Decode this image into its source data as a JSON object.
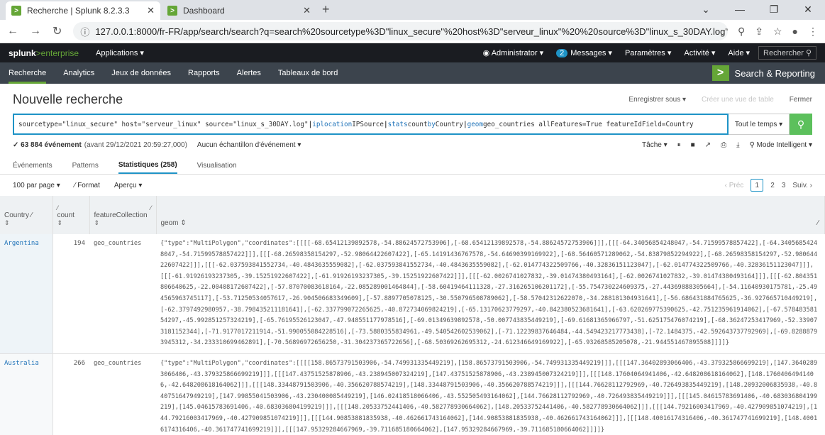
{
  "browser": {
    "tabs": [
      {
        "title": "Recherche | Splunk 8.2.3.3"
      },
      {
        "title": "Dashboard"
      }
    ],
    "url": "127.0.0.1:8000/fr-FR/app/search/search?q=search%20sourcetype%3D\"linux_secure\"%20host%3D\"serveur_linux\"%20%20source%3D\"linux_s_30DAY.log\"%2..."
  },
  "top": {
    "logo_a": "splunk",
    "logo_b": ">enterprise",
    "apps": "Applications ▾",
    "admin": "Administrator ▾",
    "msg_count": "2",
    "messages": "Messages ▾",
    "params": "Paramètres ▾",
    "activite": "Activité ▾",
    "aide": "Aide ▾",
    "search_btn": "Rechercher"
  },
  "nav": {
    "items": [
      "Recherche",
      "Analytics",
      "Jeux de données",
      "Rapports",
      "Alertes",
      "Tableaux de bord"
    ],
    "app": "Search & Reporting"
  },
  "page": {
    "title": "Nouvelle recherche",
    "save": "Enregistrer sous ▾",
    "create": "Créer une vue de table",
    "close": "Fermer"
  },
  "search": {
    "q1": "sourcetype=\"linux_secure\" host=\"serveur_linux\"  source=\"linux_s_30DAY.log\" ",
    "p1": "| ",
    "c1": "iplocation",
    "a1": " IPSource ",
    "p2": "| ",
    "c2": "stats",
    "a2": " count ",
    "k2": "by",
    " a2b": "",
    "a2c": " Country ",
    "p3": "| ",
    "c3": "geom",
    "a3": " geo_countries allFeatures=True featureIdField=Country",
    "time": "Tout le temps ▾"
  },
  "info": {
    "count": "✓ 63 884 événement",
    "range": "(avant 29/12/2021 20:59:27,000)",
    "sampling": "Aucun échantillon d'événement ▾",
    "job": "Tâche ▾",
    "mode": "⚲ Mode Intelligent ▾"
  },
  "tabs": [
    "Événements",
    "Patterns",
    "Statistiques (258)",
    "Visualisation"
  ],
  "tools": {
    "per_page": "100 par page ▾",
    "format": "⁄ Format",
    "preview": "Aperçu ▾",
    "prev": "‹ Préc",
    "p1": "1",
    "p2": "2",
    "p3": "3",
    "next": "Suiv. ›"
  },
  "table": {
    "headers": [
      "Country",
      "count",
      "featureCollection",
      "geom ⇕"
    ],
    "rows": [
      {
        "country": "Argentina",
        "count": "194",
        "fc": "geo_countries",
        "geom": "{\"type\":\"MultiPolygon\",\"coordinates\":[[[[-68.65412139892578,-54.88624572753906],[-68.65412139892578,-54.88624572753906]]],[[[-64.34056854248047,-54.71599578857422],[-64.34056854248047,-54.71599578857422]]],[[[-68.26598358154297,-52.98064422607422],[-65.14191436767578,-54.64690399169922],[-68.56460571289062,-54.83879852294922],[-68.26598358154297,-52.98064422607422]]],[[[-62.037593841552734,-40.4843635559082],[-62.037593841552734,-40.4843635559082],[-62.014774322509766,-40.32836151123047],[-62.014774322509766,-40.32836151123047]]],[[[-61.91926193237305,-39.15251922607422],[-61.91926193237305,-39.15251922607422]]],[[[-62.0026741027832,-39.01474380493164],[-62.0026741027832,-39.01474380493164]]],[[[-62.804351806640625,-22.00408172607422],[-57.87070083618164,-22.085289001464844],[-58.60419464111328,-27.316265106201172],[-55.754730224609375,-27.44369888305664],[-54.11640930175781,-25.494565963745117],[-53.71250534057617,-26.904506683349609],[-57.8897705078125,-30.550796508789062],[-58.57042312622070,-34.288181304931641],[-56.686431884765625,-36.927665710449219],[-62.3797492980957,-38.798435211181641],[-62.337799072265625,-40.872734069824219],[-65.13170623779297,-40.842380523681641],[-63.620269775390625,-42.751235961914062],[-67.57848358154297,-45.992851257324219],[-65.76195526123047,-47.948551177978516],[-69.01349639892578,-50.007743835449219],[-69.61681365966797,-51.625175476074219],[-68.36247253417969,-52.339073181152344],[-71.9177017211914,-51.990055084228516],[-73.5880355834961,-49.540542602539062],[-71.12239837646484,-44.549423217773438],[-72.1484375,-42.592643737792969],[-69.82888793945312,-34.233310699462891],[-70.56896972656250,-31.304237365722656],[-68.50369262695312,-24.612346649169922],[-65.93268585205078,-21.944551467895508]]]]}"
      },
      {
        "country": "Australia",
        "count": "266",
        "fc": "geo_countries",
        "geom": "{\"type\":\"MultiPolygon\",\"coordinates\":[[[[158.86573791503906,-54.749931335449219],[158.86573791503906,-54.749931335449219]]],[[[147.36402893066406,-43.379325866699219],[147.36402893066406,-43.379325866699219]]],[[[147.43751525878906,-43.238945007324219],[147.43751525878906,-43.238945007324219]]],[[[148.17604064941406,-42.648208618164062],[148.17604064941406,-42.648208618164062]]],[[[148.33448791503906,-40.356620788574219],[148.33448791503906,-40.356620788574219]]],[[[144.76628112792969,-40.726493835449219],[148.20932006835938,-40.840751647949219],[147.99855041503906,-43.230400085449219],[146.02418518066406,-43.552505493164062],[144.76628112792969,-40.726493835449219]]],[[[145.04615783691406,-40.683036804199219],[145.04615783691406,-40.683036804199219]]],[[[148.20533752441406,-40.582778930664062],[148.20533752441406,-40.582778930664062]]],[[[144.79216003417969,-40.427909851074219],[144.79216003417969,-40.427909851074219]]],[[[144.90853881835938,-40.462661743164062],[144.90853881835938,-40.462661743164062]]],[[[148.40016174316406,-40.361747741699219],[148.40016174316406,-40.361747741699219]]],[[[147.95329284667969,-39.711685180664062],[147.95329284667969,-39.711685180664062]]]]}"
      }
    ]
  }
}
